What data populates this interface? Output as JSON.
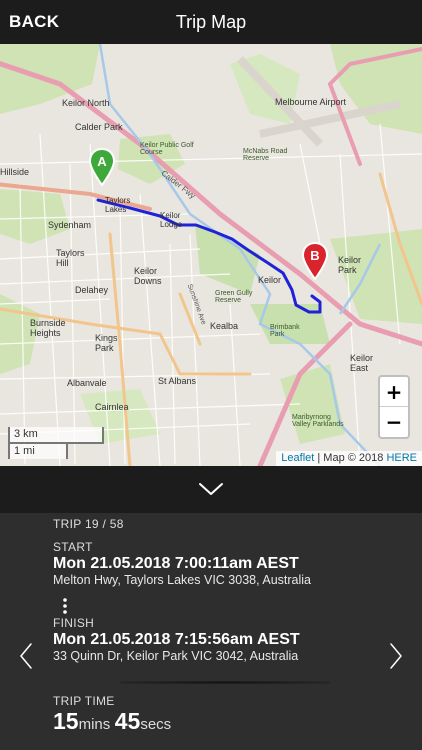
{
  "header": {
    "back_label": "BACK",
    "title": "Trip Map"
  },
  "map": {
    "zoom_in_label": "+",
    "zoom_out_label": "−",
    "scale_km": "3 km",
    "scale_mi": "1 mi",
    "attribution_leaflet": "Leaflet",
    "attribution_separator": " | Map © 2018 ",
    "attribution_here": "HERE",
    "route_color": "#1f22d6",
    "marker_start_label": "A",
    "marker_end_label": "B",
    "place_labels": [
      "Keilor North",
      "Calder Park",
      "Melbourne Airport",
      "Keilor Public Golf Course",
      "McNabs Road Reserve",
      "Hillside",
      "Taylors Lakes",
      "Sydenham",
      "Taylors Hill",
      "Keilor Lodge",
      "Keilor Downs",
      "Delahey",
      "Keilor",
      "Keilor Park",
      "Burnside Heights",
      "Kings Park",
      "Kealba",
      "St Albans",
      "Albanvale",
      "Cairnlea",
      "Keilor East",
      "Calder Fwy",
      "Sunshine Ave",
      "Green Gully Reserve",
      "Brimbank Park",
      "Maribyrnong Valley Parklands"
    ]
  },
  "trip": {
    "counter": "TRIP 19 / 58",
    "start_label": "START",
    "start_datetime": "Mon 21.05.2018 7:00:11am AEST",
    "start_address": "Melton Hwy, Taylors Lakes VIC 3038, Australia",
    "finish_label": "FINISH",
    "finish_datetime": "Mon 21.05.2018 7:15:56am AEST",
    "finish_address": "33 Quinn Dr, Keilor Park VIC 3042, Australia",
    "time_label": "TRIP TIME",
    "minutes": "15",
    "minutes_unit": "mins",
    "seconds": "45",
    "seconds_unit": "secs"
  }
}
